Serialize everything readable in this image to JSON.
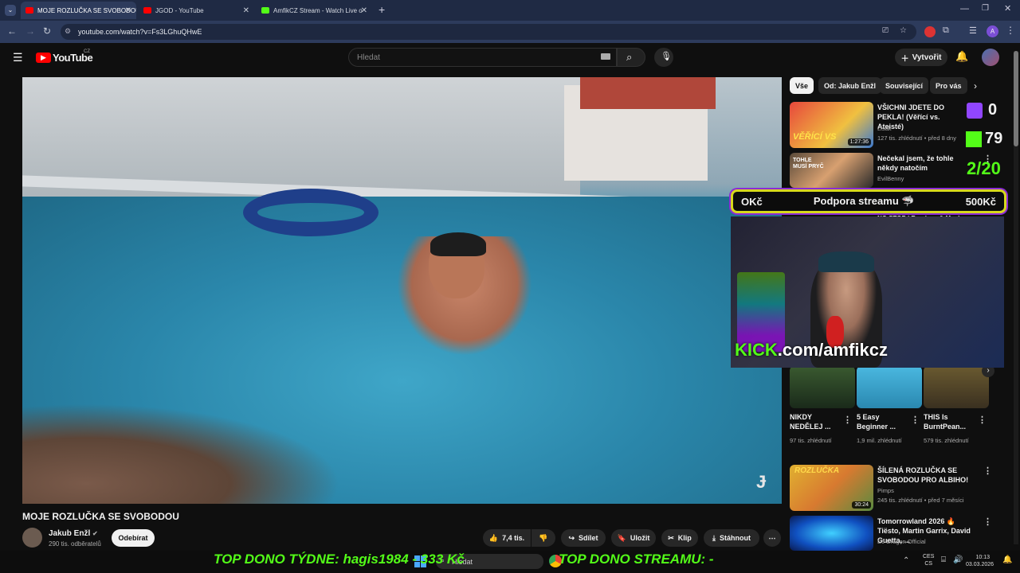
{
  "browser": {
    "tabs": [
      {
        "label": "MOJE ROZLUČKA SE SVOBODOU",
        "active": true
      },
      {
        "label": "JGOD - YouTube",
        "active": false
      },
      {
        "label": "AmfikCZ Stream - Watch Live o",
        "active": false
      }
    ],
    "url": "youtube.com/watch?v=Fs3LGhuQHwE"
  },
  "header": {
    "logo": "YouTube",
    "region": "CZ",
    "search_placeholder": "Hledat",
    "create_label": "Vytvořit"
  },
  "video": {
    "title": "MOJE ROZLUČKA SE SVOBODOU",
    "channel": "Jakub Enžl",
    "subscribers": "290 tis. odběratelů",
    "subscribe_label": "Odebírat",
    "likes": "7,4 tis.",
    "share_label": "Sdílet",
    "save_label": "Uložit",
    "clip_label": "Klip",
    "download_label": "Stáhnout"
  },
  "chips": [
    "Vše",
    "Od: Jakub Enžl",
    "Související",
    "Pro vás"
  ],
  "sidebar": {
    "videos": [
      {
        "title": "VŠICHNI JDETE DO PEKLA! (Věřící vs. Ateisté)",
        "channel": "Lišák",
        "meta": "127 tis. zhlédnutí • před 8 dny",
        "duration": "1:27:36",
        "thumb_text": "VĚŘÍCÍ VS"
      },
      {
        "title": "Nečekal jsem, že tohle někdy natočím",
        "channel": "EvilBenny",
        "meta": "",
        "duration": "",
        "thumb_text": "TOHLE MUSÍ PRYČ"
      },
      {
        "title": "NO STOP | Remixes & Mashup...",
        "channel": "",
        "meta": "",
        "duration": ""
      },
      {
        "title": "ŠÍLENÁ ROZLUČKA SE SVOBODOU PRO ALBIHO!",
        "channel": "Pimps",
        "meta": "245 tis. zhlédnutí • před 7 měsíci",
        "duration": "30:24",
        "thumb_text": "ROZLUČKA"
      },
      {
        "title": "Tomorrowland 2026 🔥 Tiësto, Martin Garrix, David Guetta, ...",
        "channel": "DJ Dragon Official",
        "meta": "",
        "duration": ""
      }
    ],
    "shorts": [
      {
        "title": "NIKDY NEDĚLEJ ...",
        "views": "97 tis. zhlédnutí"
      },
      {
        "title": "5 Easy Beginner ...",
        "views": "1,9 mil. zhlédnutí"
      },
      {
        "title": "THIS Is BurntPean...",
        "views": "579 tis. zhlédnutí"
      }
    ]
  },
  "overlay": {
    "left": "OKč",
    "center": "Podpora streamu",
    "right": "500Kč",
    "twitch_count": "0",
    "kick_count": "79",
    "progress_text": "2/20",
    "kick_brand": "KICK",
    "kick_url": ".com/amfikcz",
    "ticker_week": "TOP DONO TÝDNE:  hagis1984 - 333 Kč",
    "ticker_stream": "TOP DONO STREAMU: -"
  },
  "taskbar": {
    "search": "Hledat",
    "lang": "CES",
    "lang2": "CS",
    "time": "10:13",
    "date": "03.03.2026"
  }
}
